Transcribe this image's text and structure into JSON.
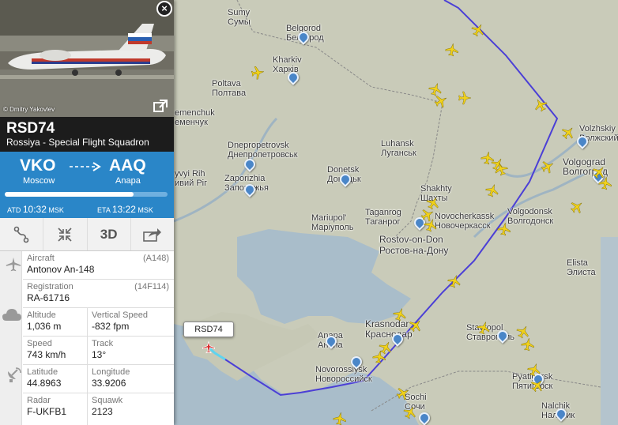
{
  "flight": {
    "callsign": "RSD74",
    "airline": "Rossiya - Special Flight Squadron",
    "photo_credit": "© Dmitry Yakovlev",
    "origin_code": "VKO",
    "origin_city": "Moscow",
    "destination_code": "AAQ",
    "destination_city": "Anapa",
    "progress_fraction": 0.79,
    "atd_label": "ATD",
    "atd_time": "10:32",
    "atd_tz": "MSK",
    "eta_label": "ETA",
    "eta_time": "13:22",
    "eta_tz": "MSK"
  },
  "toolbar": {
    "three_d_label": "3D"
  },
  "details": {
    "aircraft_label": "Aircraft",
    "aircraft_code": "(A148)",
    "aircraft_value": "Antonov An-148",
    "registration_label": "Registration",
    "registration_code": "(14F114)",
    "registration_value": "RA-61716",
    "altitude_label": "Altitude",
    "altitude_value": "1,036 m",
    "vspeed_label": "Vertical Speed",
    "vspeed_value": "-832 fpm",
    "speed_label": "Speed",
    "speed_value": "743 km/h",
    "track_label": "Track",
    "track_value": "13°",
    "latitude_label": "Latitude",
    "latitude_value": "44.8963",
    "longitude_label": "Longitude",
    "longitude_value": "33.9206",
    "radar_label": "Radar",
    "radar_value": "F-UKFB1",
    "squawk_label": "Squawk",
    "squawk_value": "2123"
  },
  "map": {
    "callout_label": "RSD74",
    "cities": [
      {
        "en": "Sumy",
        "ru": "Сумы"
      },
      {
        "en": "Belgorod",
        "ru": "Белгород"
      },
      {
        "en": "Kharkiv",
        "ru": "Харків"
      },
      {
        "en": "Poltava",
        "ru": "Полтава"
      },
      {
        "en": "emenchuk",
        "ru": "еменчук"
      },
      {
        "en": "Dnepropetrovsk",
        "ru": "Днепропетровськ"
      },
      {
        "en": "Luhansk",
        "ru": "Луганськ"
      },
      {
        "en": "Donetsk",
        "ru": "Донецьк"
      },
      {
        "en": "Zaporizhia",
        "ru": "Запорожья"
      },
      {
        "en": "yvyi Rih",
        "ru": "ивий Ріг"
      },
      {
        "en": "Shakhty",
        "ru": "Шахты"
      },
      {
        "en": "Mariupol'",
        "ru": "Маріуполь"
      },
      {
        "en": "Taganrog",
        "ru": "Таганрог"
      },
      {
        "en": "Novocherkassk",
        "ru": "Новочеркасск"
      },
      {
        "en": "Rostov-on-Don",
        "ru": "Ростов-на-Дону"
      },
      {
        "en": "Volzhskiy",
        "ru": "Волжский"
      },
      {
        "en": "Volgograd",
        "ru": "Волгоград"
      },
      {
        "en": "Volgodonsk",
        "ru": "Волгодонск"
      },
      {
        "en": "Elista",
        "ru": "Элиста"
      },
      {
        "en": "Krasnodar",
        "ru": "Краснодар"
      },
      {
        "en": "Anapa",
        "ru": "Анапа"
      },
      {
        "en": "Novorossiysk",
        "ru": "Новороссийск"
      },
      {
        "en": "Stavropol",
        "ru": "Ставрополь"
      },
      {
        "en": "Pyatigorsk",
        "ru": "Пятигорск"
      },
      {
        "en": "Sochi",
        "ru": "Сочи"
      },
      {
        "en": "Nalchik",
        "ru": "Нальчик"
      }
    ]
  },
  "colors": {
    "accent": "#2a86c8",
    "header": "#1c1c1c",
    "flight_path": "#4b3fd6",
    "plane_marker": "#f2d21a",
    "selected_plane": "#d82a2a"
  }
}
